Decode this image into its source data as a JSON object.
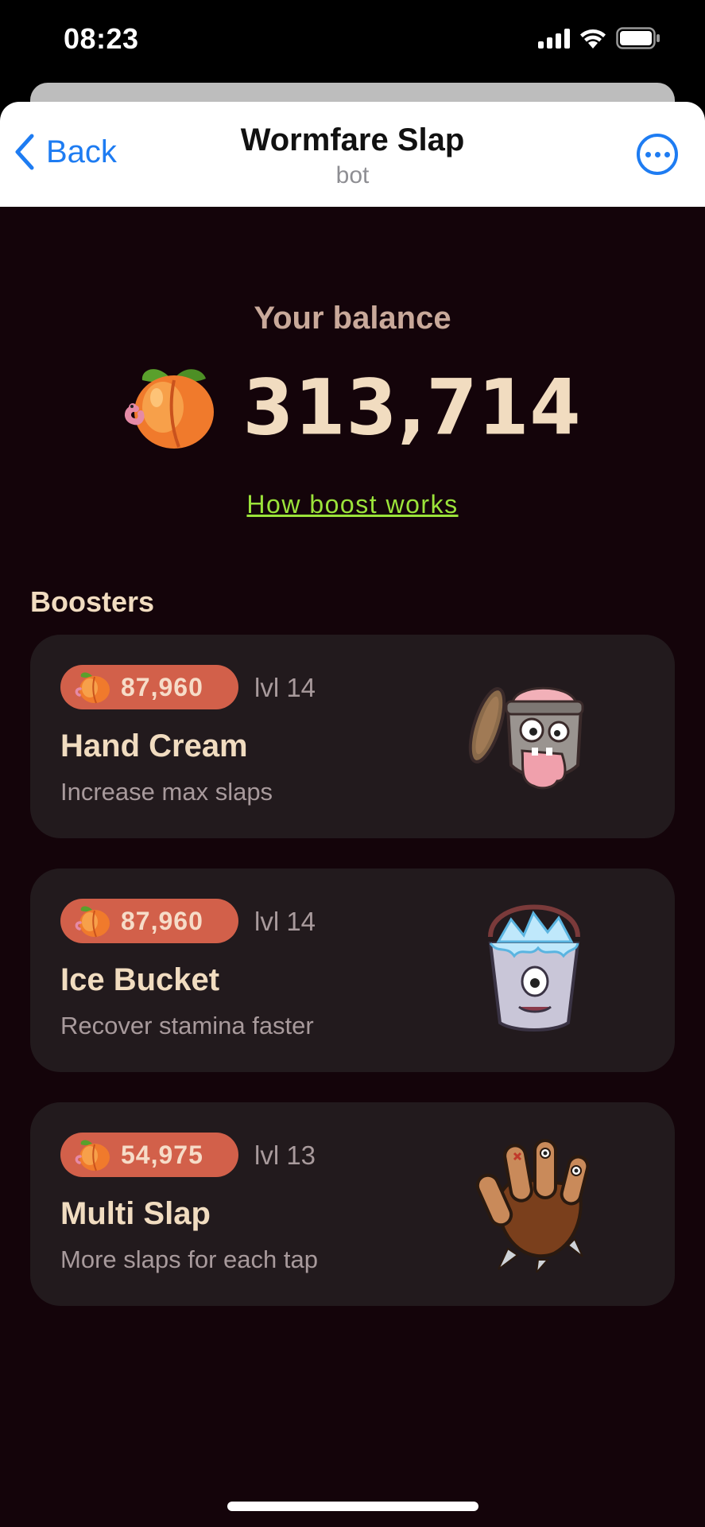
{
  "status_bar": {
    "time": "08:23"
  },
  "header": {
    "back_label": "Back",
    "title": "Wormfare Slap",
    "subtitle": "bot"
  },
  "balance": {
    "label": "Your balance",
    "value": "313,714",
    "currency_icon": "peach-icon"
  },
  "boost_link": "How boost works",
  "boosters": {
    "title": "Boosters",
    "items": [
      {
        "price": "87,960",
        "level": "lvl 14",
        "name": "Hand Cream",
        "description": "Increase max slaps",
        "icon": "hand-cream-jar-icon"
      },
      {
        "price": "87,960",
        "level": "lvl 14",
        "name": "Ice Bucket",
        "description": "Recover stamina faster",
        "icon": "ice-bucket-icon"
      },
      {
        "price": "54,975",
        "level": "lvl 13",
        "name": "Multi Slap",
        "description": "More slaps for each tap",
        "icon": "slap-hand-icon"
      }
    ]
  },
  "colors": {
    "background": "#14040a",
    "card": "#221a1d",
    "badge": "#d2604a",
    "accent_text": "#f1dcc0",
    "link": "#9be33a",
    "ios_blue": "#1e7cf2"
  }
}
